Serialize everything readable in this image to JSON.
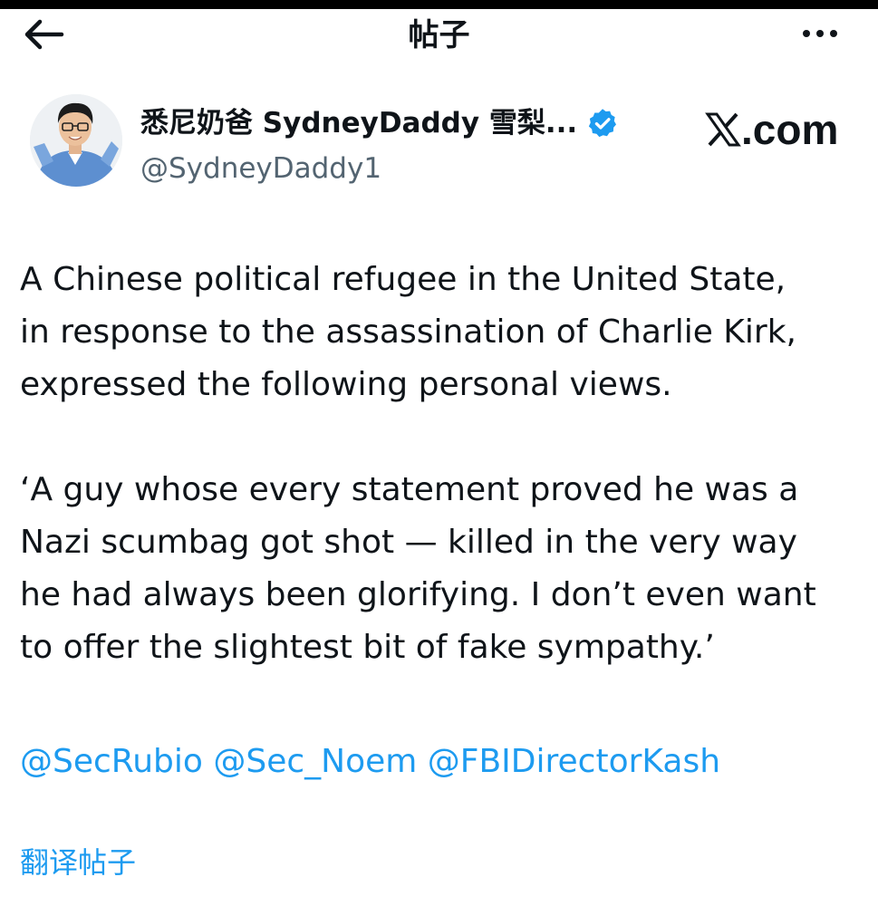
{
  "header": {
    "title": "帖子",
    "back_icon": "arrow-left-icon",
    "more_icon": "more-horizontal-icon"
  },
  "author": {
    "display_name": "悉尼奶爸 SydneyDaddy 雪梨...",
    "handle": "@SydneyDaddy1",
    "verified_icon": "verified-badge-icon",
    "verified_color": "#1d9bf0"
  },
  "source": {
    "logo_text": ".com",
    "logo_icon": "x-logo-icon"
  },
  "tweet": {
    "paragraph1_lines": [
      "A Chinese political refugee in the United State,",
      "in response to the assassination of Charlie Kirk,",
      "expressed the following personal views."
    ],
    "paragraph2_lines": [
      "‘A guy whose every statement proved he was a",
      "Nazi scumbag got shot — killed in the very way",
      "he had always been glorifying. I don’t even want",
      "to offer the slightest bit of fake sympathy.’"
    ],
    "mentions": [
      "@SecRubio",
      "@Sec_Noem",
      "@FBIDirectorKash"
    ]
  },
  "translate_label": "翻译帖子",
  "colors": {
    "accent": "#1d9bf0",
    "text": "#0f1419",
    "secondary_text": "#536471"
  }
}
